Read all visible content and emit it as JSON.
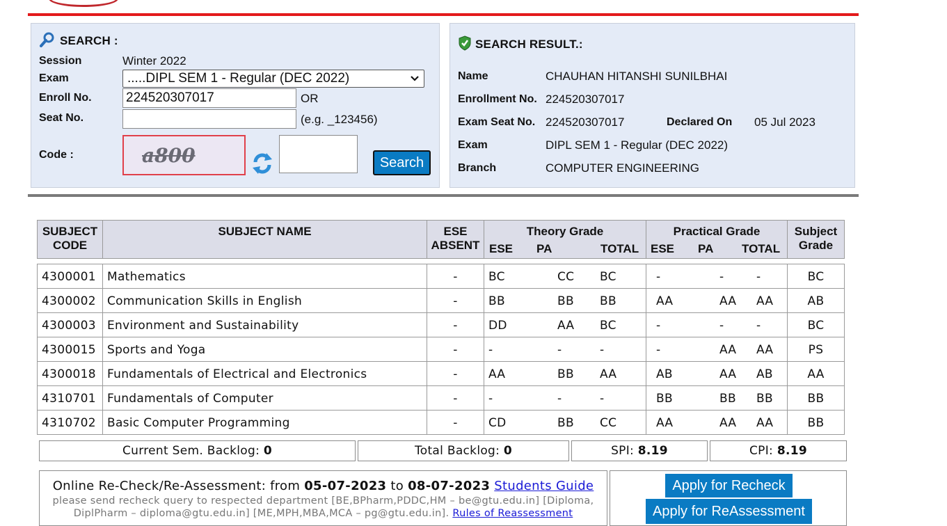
{
  "search": {
    "title": "SEARCH :",
    "session_label": "Session",
    "session_value": "Winter 2022",
    "exam_label": "Exam",
    "exam_value": ".....DIPL SEM 1 - Regular (DEC 2022)",
    "enroll_label": "Enroll No.",
    "enroll_value": "224520307017",
    "or_text": "OR",
    "seat_label": "Seat No.",
    "seat_value": "",
    "seat_hint": "(e.g. _123456)",
    "code_label": "Code :",
    "captcha_text": "a800",
    "code_value": "",
    "search_button": "Search"
  },
  "result": {
    "title": "SEARCH RESULT.:",
    "name_label": "Name",
    "name_value": "CHAUHAN HITANSHI SUNILBHAI",
    "enroll_label": "Enrollment No.",
    "enroll_value": "224520307017",
    "seat_label": "Exam Seat No.",
    "seat_value": "224520307017",
    "declared_label": "Declared On",
    "declared_value": "05 Jul 2023",
    "exam_label": "Exam",
    "exam_value": "DIPL SEM 1 - Regular (DEC 2022)",
    "branch_label": "Branch",
    "branch_value": "COMPUTER ENGINEERING"
  },
  "table": {
    "headers": {
      "code": "SUBJECT CODE",
      "name": "SUBJECT NAME",
      "ese_absent": "ESE ABSENT",
      "theory": "Theory Grade",
      "practical": "Practical Grade",
      "grade": "Subject Grade",
      "ese": "ESE",
      "pa": "PA",
      "total": "TOTAL"
    },
    "rows": [
      {
        "code": "4300001",
        "name": "Mathematics",
        "absent": "-",
        "t_ese": "BC",
        "t_pa": "CC",
        "t_total": "BC",
        "p_ese": "-",
        "p_pa": "-",
        "p_total": "-",
        "grade": "BC"
      },
      {
        "code": "4300002",
        "name": "Communication Skills in English",
        "absent": "-",
        "t_ese": "BB",
        "t_pa": "BB",
        "t_total": "BB",
        "p_ese": "AA",
        "p_pa": "AA",
        "p_total": "AA",
        "grade": "AB"
      },
      {
        "code": "4300003",
        "name": "Environment and Sustainability",
        "absent": "-",
        "t_ese": "DD",
        "t_pa": "AA",
        "t_total": "BC",
        "p_ese": "-",
        "p_pa": "-",
        "p_total": "-",
        "grade": "BC"
      },
      {
        "code": "4300015",
        "name": "Sports and Yoga",
        "absent": "-",
        "t_ese": "-",
        "t_pa": "-",
        "t_total": "-",
        "p_ese": "-",
        "p_pa": "AA",
        "p_total": "AA",
        "grade": "PS"
      },
      {
        "code": "4300018",
        "name": "Fundamentals of Electrical and Electronics",
        "absent": "-",
        "t_ese": "AA",
        "t_pa": "BB",
        "t_total": "AA",
        "p_ese": "AB",
        "p_pa": "AA",
        "p_total": "AB",
        "grade": "AA"
      },
      {
        "code": "4310701",
        "name": "Fundamentals of Computer",
        "absent": "-",
        "t_ese": "-",
        "t_pa": "-",
        "t_total": "-",
        "p_ese": "BB",
        "p_pa": "BB",
        "p_total": "BB",
        "grade": "BB"
      },
      {
        "code": "4310702",
        "name": "Basic Computer Programming",
        "absent": "-",
        "t_ese": "CD",
        "t_pa": "BB",
        "t_total": "CC",
        "p_ese": "AA",
        "p_pa": "AA",
        "p_total": "AA",
        "grade": "BB"
      }
    ]
  },
  "summary": {
    "current_backlog_label": "Current Sem. Backlog:",
    "current_backlog_value": "0",
    "total_backlog_label": "Total Backlog:",
    "total_backlog_value": "0",
    "spi_label": "SPI:",
    "spi_value": "8.19",
    "cpi_label": "CPI:",
    "cpi_value": "8.19"
  },
  "recheck": {
    "line1_prefix": "Online Re-Check/Re-Assessment: from",
    "from_date": "05-07-2023",
    "to_word": "to",
    "to_date": "08-07-2023",
    "guide_link": "Students Guide",
    "line2": "please send recheck query to respected department [BE,BPharm,PDDC,HM – be@gtu.edu.in] [Diploma,",
    "line3": "DiplPharm – diploma@gtu.edu.in] [ME,MPH,MBA,MCA – pg@gtu.edu.in].",
    "rules_link": "Rules of Reassessment",
    "apply_recheck": "Apply for Recheck",
    "apply_reassessment": "Apply for ReAssessment"
  },
  "colors": {
    "accent_red": "#e3191b",
    "panel_bg": "#e4ebf7",
    "button_blue": "#0a7bc3",
    "header_bg": "#dcdde8"
  }
}
